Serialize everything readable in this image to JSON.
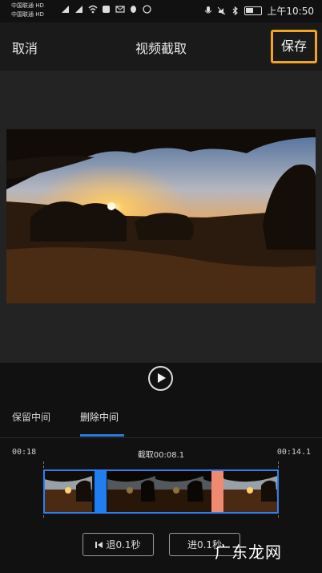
{
  "status_bar": {
    "carrier1": "中国联通 HD",
    "carrier2": "中国联通 HD",
    "time": "上午10:50"
  },
  "header": {
    "cancel_label": "取消",
    "title": "视频截取",
    "save_label": "保存",
    "save_highlight_color": "#f1a51d"
  },
  "tabs": [
    {
      "label": "保留中间"
    },
    {
      "label": "删除中间"
    }
  ],
  "timeline": {
    "start_time": "00:18",
    "selection_label": "截取00:08.1",
    "end_time": "00:14.1",
    "accent": "#2e7ff0"
  },
  "buttons": {
    "back_label": "退0.1秒",
    "forward_label": "进0.1秒"
  },
  "watermark": "广东龙网",
  "icons": {
    "play": "play-icon",
    "step_back": "skip-back-icon"
  }
}
